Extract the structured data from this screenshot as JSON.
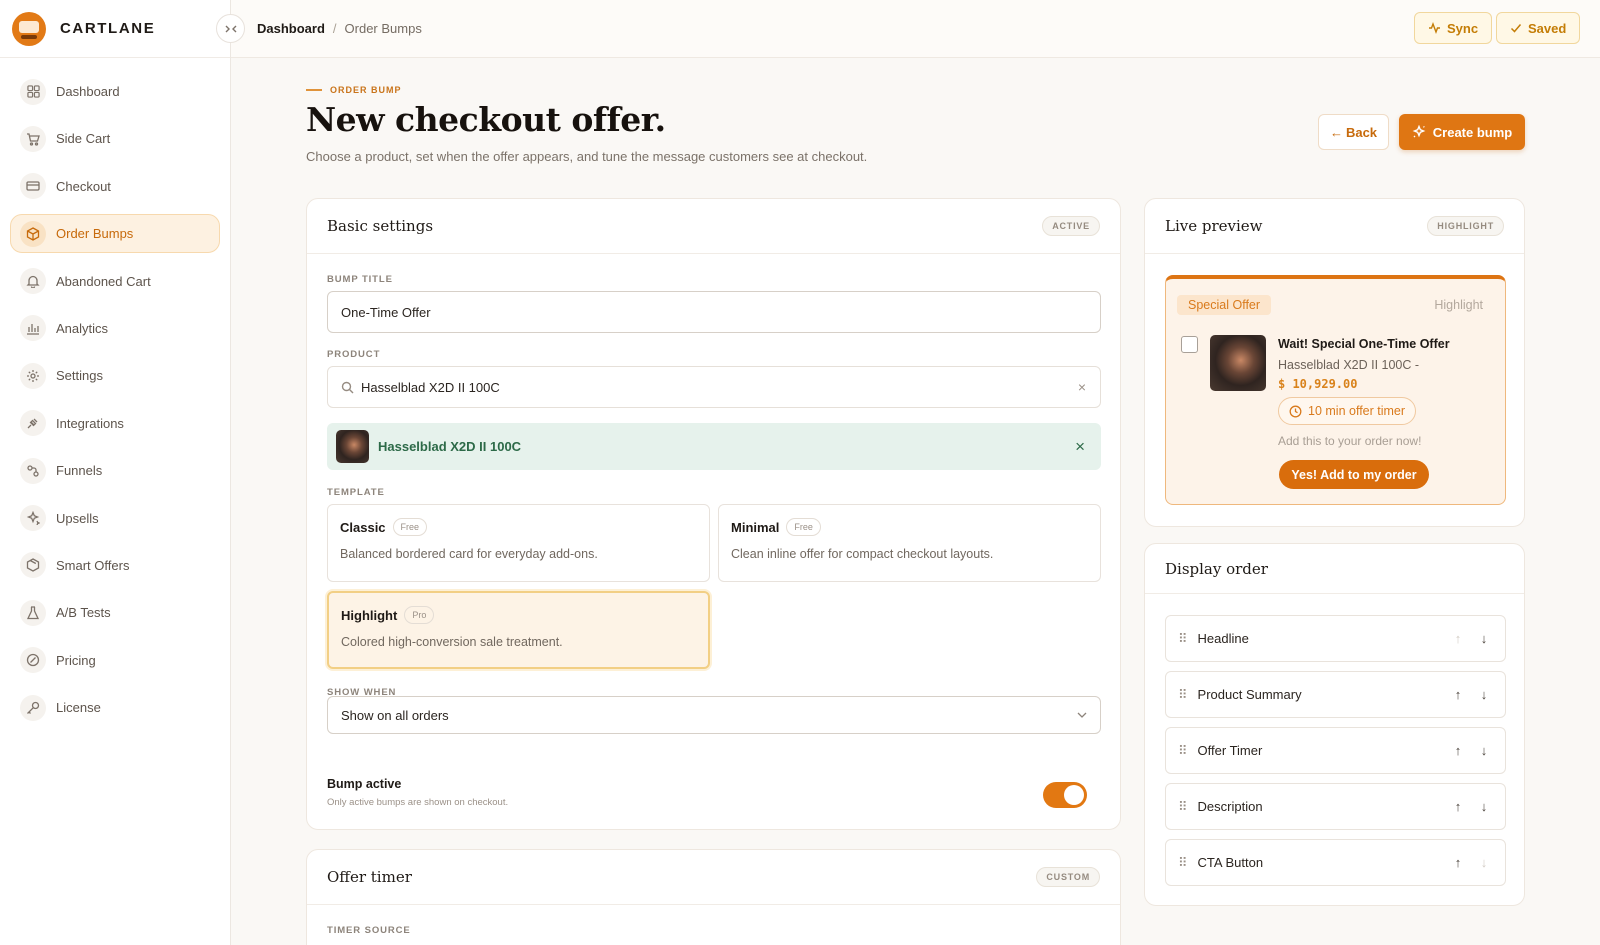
{
  "app": {
    "brand": "CARTLANE"
  },
  "sidebar": {
    "items": [
      {
        "label": "Dashboard",
        "icon": "grid-icon"
      },
      {
        "label": "Side Cart",
        "icon": "cart-icon"
      },
      {
        "label": "Checkout",
        "icon": "card-icon"
      },
      {
        "label": "Order Bumps",
        "icon": "box-icon",
        "active": true
      },
      {
        "label": "Abandoned Cart",
        "icon": "bell-icon"
      },
      {
        "label": "Analytics",
        "icon": "bar-chart-icon"
      },
      {
        "label": "Settings",
        "icon": "gear-icon"
      },
      {
        "label": "Integrations",
        "icon": "plug-icon"
      },
      {
        "label": "Funnels",
        "icon": "funnel-icon"
      },
      {
        "label": "Upsells",
        "icon": "sparkle-icon"
      },
      {
        "label": "Smart Offers",
        "icon": "package-icon"
      },
      {
        "label": "A/B Tests",
        "icon": "flask-icon"
      },
      {
        "label": "Pricing",
        "icon": "tag-icon"
      },
      {
        "label": "License",
        "icon": "key-icon"
      }
    ]
  },
  "topbar": {
    "breadcrumb": [
      "Dashboard",
      "/",
      "Order Bumps"
    ],
    "sync_label": "Sync",
    "saved_label": "Saved"
  },
  "header": {
    "eyebrow": "ORDER BUMP",
    "title": "New checkout offer.",
    "subtitle": "Choose a product, set when the offer appears, and tune the message customers see at checkout.",
    "back_label": "Back",
    "create_label": "Create bump"
  },
  "basic": {
    "title": "Basic settings",
    "badge": "ACTIVE",
    "bump_title_label": "BUMP TITLE",
    "bump_title_value": "One-Time Offer",
    "product_label": "PRODUCT",
    "product_search": "Hasselblad X2D II 100C",
    "selected_product": "Hasselblad X2D II 100C",
    "template_label": "TEMPLATE",
    "templates": [
      {
        "name": "Classic",
        "badge": "Free",
        "desc": "Balanced bordered card for everyday add-ons."
      },
      {
        "name": "Minimal",
        "badge": "Free",
        "desc": "Clean inline offer for compact checkout layouts."
      },
      {
        "name": "Highlight",
        "badge": "Pro",
        "desc": "Colored high-conversion sale treatment.",
        "selected": true
      }
    ],
    "show_when_label": "SHOW WHEN",
    "show_when_value": "Show on all orders",
    "active_label": "Bump active",
    "active_hint": "Only active bumps are shown on checkout.",
    "active": true
  },
  "timer": {
    "title": "Offer timer",
    "badge": "CUSTOM",
    "source_label": "TIMER SOURCE"
  },
  "preview": {
    "title": "Live preview",
    "badge": "HIGHLIGHT",
    "tag": "Special Offer",
    "style": "Highlight",
    "headline": "Wait! Special One-Time Offer",
    "product": "Hasselblad X2D II 100C -",
    "price": "$ 10,929.00",
    "timer": "10 min offer timer",
    "desc": "Add this to your order now!",
    "cta": "Yes! Add to my order"
  },
  "display_order": {
    "title": "Display order",
    "items": [
      "Headline",
      "Product Summary",
      "Offer Timer",
      "Description",
      "CTA Button"
    ]
  },
  "colors": {
    "accent": "#df7613",
    "accent_soft": "#fdf1e1",
    "success_bg": "#e6f2ec",
    "success_text": "#2d6a48"
  }
}
